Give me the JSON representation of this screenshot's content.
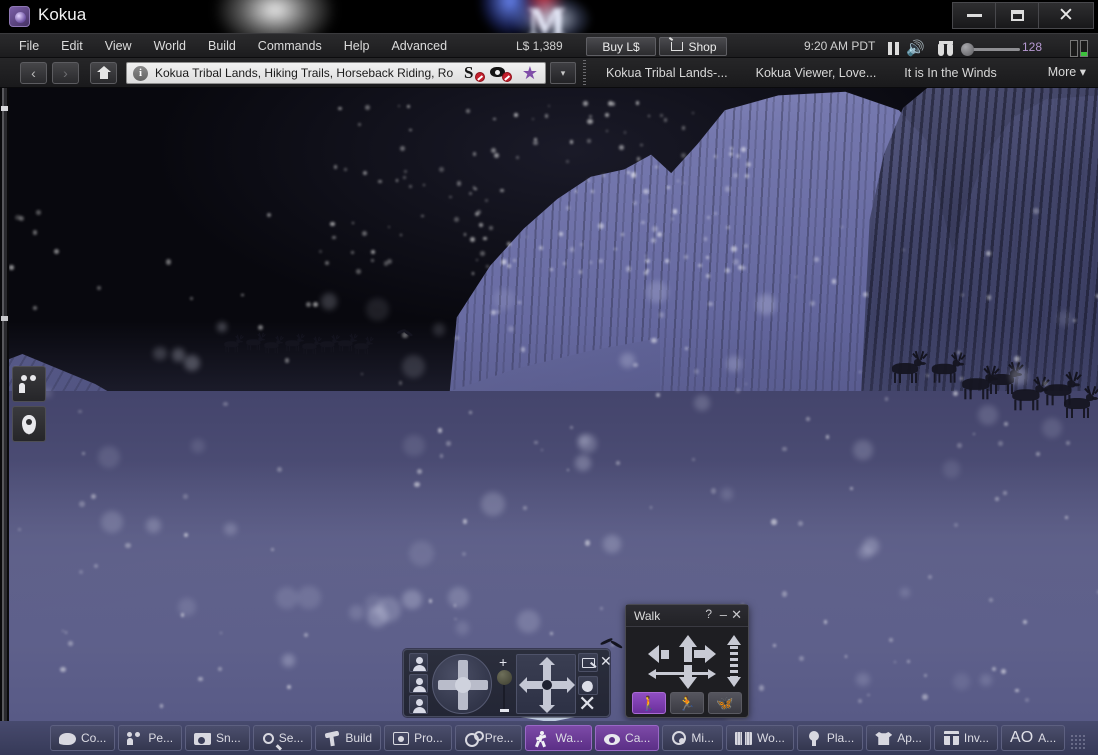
{
  "window": {
    "title": "Kokua",
    "app_icon": "kokua-logo-icon",
    "minimize_label": "–",
    "maximize_label": "□",
    "close_label": "✕"
  },
  "menubar": {
    "items": [
      {
        "label": "File"
      },
      {
        "label": "Edit"
      },
      {
        "label": "View"
      },
      {
        "label": "World"
      },
      {
        "label": "Build"
      },
      {
        "label": "Commands"
      },
      {
        "label": "Help"
      },
      {
        "label": "Advanced"
      }
    ],
    "balance": "L$ 1,389",
    "buy_label": "Buy L$",
    "shop_label": "Shop",
    "clock": "9:20 AM PDT",
    "bandwidth": "128"
  },
  "navbar": {
    "back_label": "‹",
    "forward_label": "›",
    "home_label": "home-icon",
    "info_label": "i",
    "location": "Kokua Tribal Lands, Hiking Trails, Horseback Riding, Ro",
    "script_icon_label": "S",
    "star_label": "★",
    "dropdown_label": "▾",
    "favorites": [
      {
        "label": "Kokua Tribal Lands-..."
      },
      {
        "label": "Kokua Viewer, Love..."
      },
      {
        "label": "It is In the Winds"
      }
    ],
    "more_label": "More ▾"
  },
  "world": {
    "scene_description": "Snowy nighttime mountain landscape with reindeer herd and falling snow",
    "side_buttons": [
      {
        "name": "people-icon",
        "label": "people-icon"
      },
      {
        "name": "location-pin-icon",
        "label": "location-pin-icon"
      }
    ],
    "colors": {
      "sky": "#07070c",
      "snow": "#5a5c8a",
      "mountain": "#7578ae",
      "accent_purple": "#7d4aa8"
    }
  },
  "move_panel": {
    "close_label": "✕",
    "small_close_label": "✕",
    "plus_label": "+",
    "avatars": [
      "avatar-view-1",
      "avatar-view-2",
      "avatar-view-3"
    ],
    "icons": [
      "camera-icon",
      "mouselook-icon"
    ]
  },
  "walk_panel": {
    "title": "Walk",
    "help_label": "?",
    "minimize_label": "–",
    "close_label": "✕",
    "modes": [
      {
        "name": "walk-mode",
        "glyph": "⚑",
        "active": true
      },
      {
        "name": "run-mode",
        "glyph": "⚑",
        "active": false
      },
      {
        "name": "fly-mode",
        "glyph": "✈",
        "active": false
      }
    ]
  },
  "bottombar": {
    "buttons": [
      {
        "label": "Co...",
        "icon": "chat-icon",
        "active": false
      },
      {
        "label": "Pe...",
        "icon": "people-icon",
        "active": false
      },
      {
        "label": "Sn...",
        "icon": "snapshot-icon",
        "active": false
      },
      {
        "label": "Se...",
        "icon": "search-icon",
        "active": false
      },
      {
        "label": "Build",
        "icon": "build-hammer-icon",
        "active": false
      },
      {
        "label": "Pro...",
        "icon": "profile-icon",
        "active": false
      },
      {
        "label": "Pre...",
        "icon": "preferences-gear-icon",
        "active": false
      },
      {
        "label": "Wa...",
        "icon": "walk-icon",
        "active": true
      },
      {
        "label": "Ca...",
        "icon": "camera-eye-icon",
        "active": true
      },
      {
        "label": "Mi...",
        "icon": "minimap-icon",
        "active": false
      },
      {
        "label": "Wo...",
        "icon": "world-map-icon",
        "active": false
      },
      {
        "label": "Pla...",
        "icon": "places-icon",
        "active": false
      },
      {
        "label": "Ap...",
        "icon": "appearance-shirt-icon",
        "active": false
      },
      {
        "label": "Inv...",
        "icon": "inventory-icon",
        "active": false
      },
      {
        "label": "A...",
        "icon": "ao-icon",
        "active": false
      }
    ],
    "ao_label": "AO"
  }
}
